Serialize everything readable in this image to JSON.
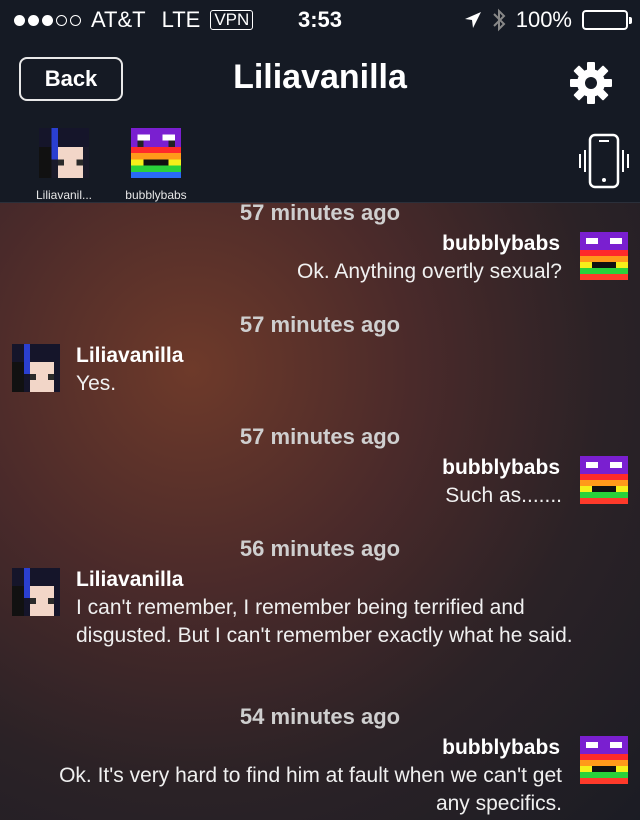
{
  "status_bar": {
    "carrier": "AT&T",
    "network": "LTE",
    "vpn": "VPN",
    "time": "3:53",
    "battery": "100%"
  },
  "nav": {
    "back_label": "Back",
    "title": "Liliavanilla"
  },
  "participants": [
    {
      "name": "Liliavanil..."
    },
    {
      "name": "bubblybabs"
    }
  ],
  "messages": [
    {
      "time": "57 minutes ago",
      "sender": "bubblybabs",
      "text": "Ok.  Anything overtly sexual?"
    },
    {
      "time": "57 minutes ago",
      "sender": "Liliavanilla",
      "text": "Yes."
    },
    {
      "time": "57 minutes ago",
      "sender": "bubblybabs",
      "text": "Such as......."
    },
    {
      "time": "56 minutes ago",
      "sender": "Liliavanilla",
      "text": "I can't remember, I remember being terrified and disgusted. But I can't remember exactly what he said."
    },
    {
      "time": "54 minutes ago",
      "sender": "bubblybabs",
      "text": "Ok.  It's very hard to find him at fault when we can't get any specifics."
    }
  ]
}
